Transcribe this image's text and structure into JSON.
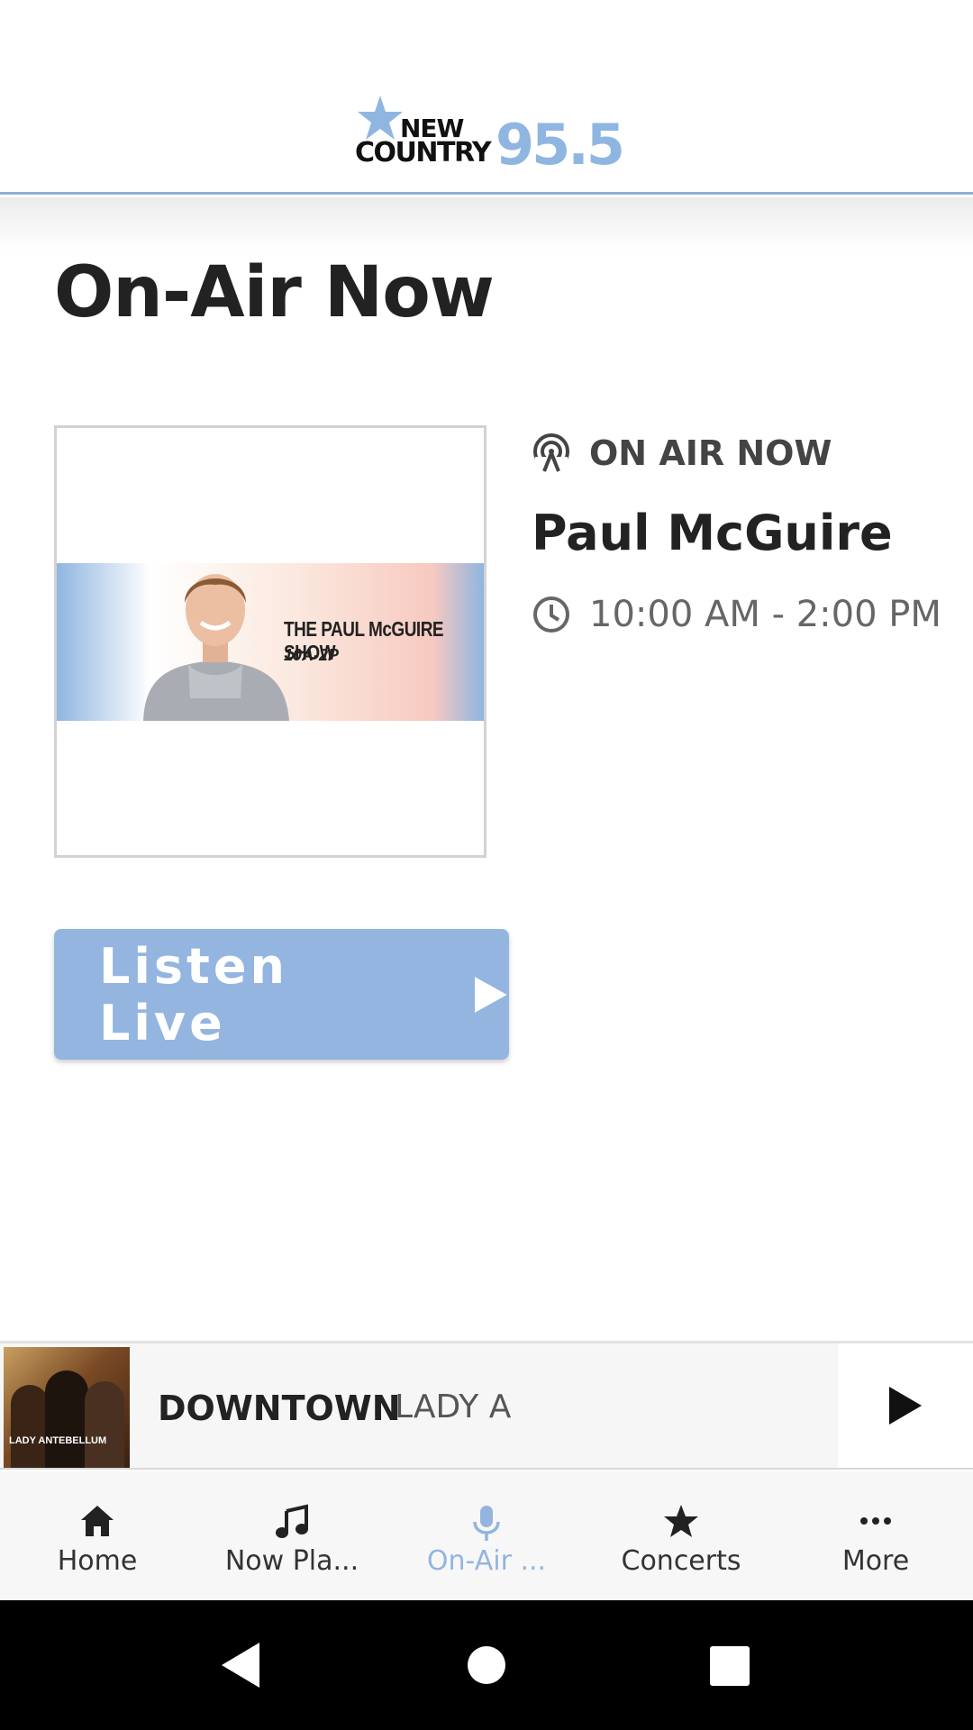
{
  "header": {
    "logo": {
      "line1": "NEW",
      "line2": "COUNTRY",
      "frequency": "95.5",
      "accent_color": "#8fb6e0"
    }
  },
  "page": {
    "title": "On-Air Now"
  },
  "show": {
    "banner_title": "THE PAUL McGUIRE SHOW",
    "banner_subtitle": "10A-2P",
    "status_label": "ON AIR NOW",
    "host": "Paul McGuire",
    "time": "10:00 AM - 2:00 PM"
  },
  "listen_button": {
    "label": "Listen Live",
    "color": "#93b5df"
  },
  "now_playing": {
    "song": "DOWNTOWN",
    "artist": "LADY A",
    "album_caption": "LADY ANTEBELLUM"
  },
  "bottom_nav": {
    "items": [
      {
        "label": "Home",
        "icon": "home-icon"
      },
      {
        "label": "Now Pla...",
        "icon": "music-note-icon"
      },
      {
        "label": "On-Air ...",
        "icon": "microphone-icon",
        "active": true
      },
      {
        "label": "Concerts",
        "icon": "star-icon"
      },
      {
        "label": "More",
        "icon": "more-dots-icon"
      }
    ]
  }
}
